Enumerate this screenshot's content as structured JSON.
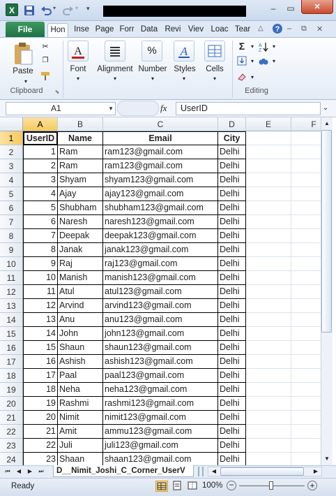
{
  "titlebar": {
    "app_icon": "X",
    "minimize": "–",
    "restore": "▭",
    "close": "✕"
  },
  "tabs": [
    "File",
    "Hon",
    "Inse",
    "Page",
    "Forr",
    "Data",
    "Revi",
    "Viev",
    "Loac",
    "Tear"
  ],
  "ribbon": {
    "paste_label": "Paste",
    "clipboard_label": "Clipboard",
    "font_label": "Font",
    "alignment_label": "Alignment",
    "number_label": "Number",
    "number_icon": "%",
    "styles_label": "Styles",
    "cells_label": "Cells",
    "editing_label": "Editing"
  },
  "formula_bar": {
    "name_box": "A1",
    "fx": "fx",
    "content": "UserID"
  },
  "columns": [
    "A",
    "B",
    "C",
    "D",
    "E",
    "F"
  ],
  "rows": [
    "1",
    "2",
    "3",
    "4",
    "5",
    "6",
    "7",
    "8",
    "9",
    "10",
    "11",
    "12",
    "13",
    "14",
    "15",
    "16",
    "17",
    "18",
    "19",
    "20",
    "21",
    "22",
    "23",
    "24"
  ],
  "table": {
    "headers": [
      "UserID",
      "Name",
      "Email",
      "City"
    ],
    "data": [
      [
        "1",
        "Ram",
        "ram123@gmail.com",
        "Delhi"
      ],
      [
        "2",
        "Ram",
        "ram123@gmail.com",
        "Delhi"
      ],
      [
        "3",
        "Shyam",
        "shyam123@gmail.com",
        "Delhi"
      ],
      [
        "4",
        "Ajay",
        "ajay123@gmail.com",
        "Delhi"
      ],
      [
        "5",
        "Shubham",
        "shubham123@gmail.com",
        "Delhi"
      ],
      [
        "6",
        "Naresh",
        "naresh123@gmail.com",
        "Delhi"
      ],
      [
        "7",
        "Deepak",
        "deepak123@gmail.com",
        "Delhi"
      ],
      [
        "8",
        "Janak",
        "janak123@gmail.com",
        "Delhi"
      ],
      [
        "9",
        "Raj",
        "raj123@gmail.com",
        "Delhi"
      ],
      [
        "10",
        "Manish",
        "manish123@gmail.com",
        "Delhi"
      ],
      [
        "11",
        "Atul",
        "atul123@gmail.com",
        "Delhi"
      ],
      [
        "12",
        "Arvind",
        "arvind123@gmail.com",
        "Delhi"
      ],
      [
        "13",
        "Anu",
        "anu123@gmail.com",
        "Delhi"
      ],
      [
        "14",
        "John",
        "john123@gmail.com",
        "Delhi"
      ],
      [
        "15",
        "Shaun",
        "shaun123@gmail.com",
        "Delhi"
      ],
      [
        "16",
        "Ashish",
        "ashish123@gmail.com",
        "Delhi"
      ],
      [
        "17",
        "Paal",
        "paal123@gmail.com",
        "Delhi"
      ],
      [
        "18",
        "Neha",
        "neha123@gmail.com",
        "Delhi"
      ],
      [
        "19",
        "Rashmi",
        "rashmi123@gmail.com",
        "Delhi"
      ],
      [
        "20",
        "Nimit",
        "nimit123@gmail.com",
        "Delhi"
      ],
      [
        "21",
        "Amit",
        "ammu123@gmail.com",
        "Delhi"
      ],
      [
        "22",
        "Juli",
        "juli123@gmail.com",
        "Delhi"
      ],
      [
        "23",
        "Shaan",
        "shaan123@gmail.com",
        "Delhi"
      ]
    ]
  },
  "sheet_tab": "D__Nimit_Joshi_C_Corner_UserV",
  "status": {
    "ready": "Ready",
    "zoom": "100%"
  }
}
